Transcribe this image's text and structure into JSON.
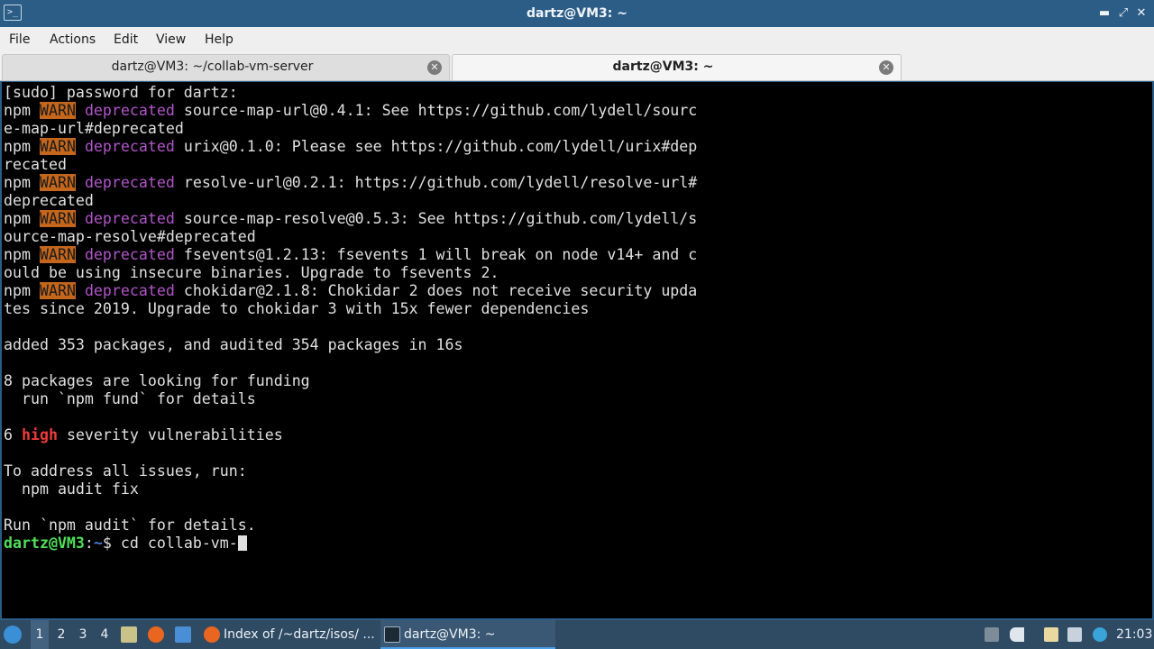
{
  "window": {
    "title": "dartz@VM3: ~",
    "buttons": {
      "minimize": "▬",
      "maximize": "⤢",
      "close": "✕"
    }
  },
  "menu": [
    "File",
    "Actions",
    "Edit",
    "View",
    "Help"
  ],
  "tabs": [
    {
      "label": "dartz@VM3: ~/collab-vm-server",
      "active": false
    },
    {
      "label": "dartz@VM3: ~",
      "active": true
    }
  ],
  "terminal": {
    "lines": [
      {
        "parts": [
          {
            "t": "[sudo] password for dartz:"
          }
        ]
      },
      {
        "parts": [
          {
            "t": "npm "
          },
          {
            "t": "WARN",
            "c": "warn"
          },
          {
            "t": " "
          },
          {
            "t": "deprecated",
            "c": "depr"
          },
          {
            "t": " source-map-url@0.4.1: See https://github.com/lydell/sourc"
          }
        ]
      },
      {
        "parts": [
          {
            "t": "e-map-url#deprecated"
          }
        ]
      },
      {
        "parts": [
          {
            "t": "npm "
          },
          {
            "t": "WARN",
            "c": "warn"
          },
          {
            "t": " "
          },
          {
            "t": "deprecated",
            "c": "depr"
          },
          {
            "t": " urix@0.1.0: Please see https://github.com/lydell/urix#dep"
          }
        ]
      },
      {
        "parts": [
          {
            "t": "recated"
          }
        ]
      },
      {
        "parts": [
          {
            "t": "npm "
          },
          {
            "t": "WARN",
            "c": "warn"
          },
          {
            "t": " "
          },
          {
            "t": "deprecated",
            "c": "depr"
          },
          {
            "t": " resolve-url@0.2.1: https://github.com/lydell/resolve-url#"
          }
        ]
      },
      {
        "parts": [
          {
            "t": "deprecated"
          }
        ]
      },
      {
        "parts": [
          {
            "t": "npm "
          },
          {
            "t": "WARN",
            "c": "warn"
          },
          {
            "t": " "
          },
          {
            "t": "deprecated",
            "c": "depr"
          },
          {
            "t": " source-map-resolve@0.5.3: See https://github.com/lydell/s"
          }
        ]
      },
      {
        "parts": [
          {
            "t": "ource-map-resolve#deprecated"
          }
        ]
      },
      {
        "parts": [
          {
            "t": "npm "
          },
          {
            "t": "WARN",
            "c": "warn"
          },
          {
            "t": " "
          },
          {
            "t": "deprecated",
            "c": "depr"
          },
          {
            "t": " fsevents@1.2.13: fsevents 1 will break on node v14+ and c"
          }
        ]
      },
      {
        "parts": [
          {
            "t": "ould be using insecure binaries. Upgrade to fsevents 2."
          }
        ]
      },
      {
        "parts": [
          {
            "t": "npm "
          },
          {
            "t": "WARN",
            "c": "warn"
          },
          {
            "t": " "
          },
          {
            "t": "deprecated",
            "c": "depr"
          },
          {
            "t": " chokidar@2.1.8: Chokidar 2 does not receive security upda"
          }
        ]
      },
      {
        "parts": [
          {
            "t": "tes since 2019. Upgrade to chokidar 3 with 15x fewer dependencies"
          }
        ]
      },
      {
        "parts": [
          {
            "t": ""
          }
        ]
      },
      {
        "parts": [
          {
            "t": "added 353 packages, and audited 354 packages in 16s"
          }
        ]
      },
      {
        "parts": [
          {
            "t": ""
          }
        ]
      },
      {
        "parts": [
          {
            "t": "8 packages are looking for funding"
          }
        ]
      },
      {
        "parts": [
          {
            "t": "  run `npm fund` for details"
          }
        ]
      },
      {
        "parts": [
          {
            "t": ""
          }
        ]
      },
      {
        "parts": [
          {
            "t": "6 "
          },
          {
            "t": "high",
            "c": "high"
          },
          {
            "t": " severity vulnerabilities"
          }
        ]
      },
      {
        "parts": [
          {
            "t": ""
          }
        ]
      },
      {
        "parts": [
          {
            "t": "To address all issues, run:"
          }
        ]
      },
      {
        "parts": [
          {
            "t": "  npm audit fix"
          }
        ]
      },
      {
        "parts": [
          {
            "t": ""
          }
        ]
      },
      {
        "parts": [
          {
            "t": "Run `npm audit` for details."
          }
        ]
      },
      {
        "parts": [
          {
            "t": "dartz@VM3",
            "c": "p-user"
          },
          {
            "t": ":"
          },
          {
            "t": "~",
            "c": "p-path"
          },
          {
            "t": "$ cd collab-vm-"
          }
        ],
        "cursor": true
      }
    ]
  },
  "taskbar": {
    "workspaces": [
      "1",
      "2",
      "3",
      "4"
    ],
    "active_workspace": "1",
    "tasks": [
      {
        "label": "Index of /~dartz/isos/ ...",
        "icon": "firefox-icon"
      },
      {
        "label": "dartz@VM3: ~",
        "icon": "terminal-icon"
      }
    ],
    "clock": "21:03"
  }
}
